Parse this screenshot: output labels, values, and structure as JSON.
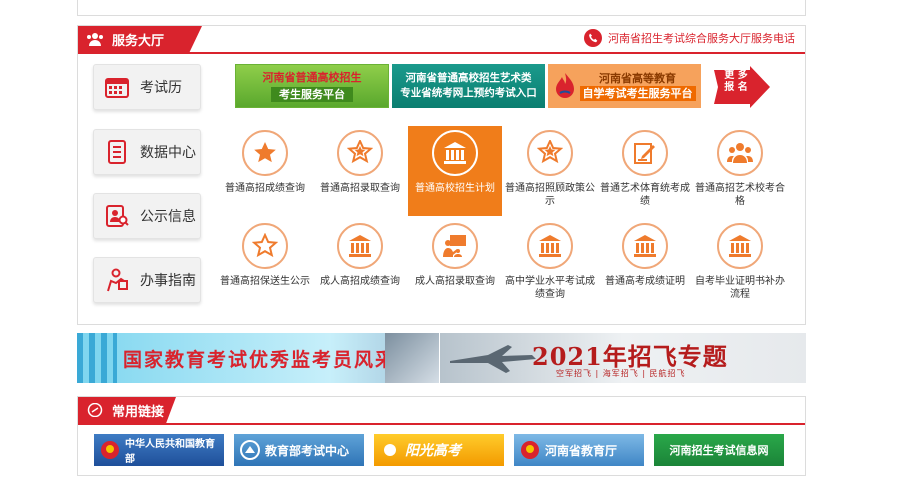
{
  "service_hall": {
    "title": "服务大厅",
    "phone_text": "河南省招生考试综合服务大厅服务电话",
    "side_menu": [
      {
        "label": "考试历",
        "icon": "calendar-icon"
      },
      {
        "label": "数据中心",
        "icon": "document-icon"
      },
      {
        "label": "公示信息",
        "icon": "person-search-icon"
      },
      {
        "label": "办事指南",
        "icon": "guide-icon"
      }
    ],
    "promos": {
      "p1_line1": "河南省普通高校招生",
      "p1_line2": "考生服务平台",
      "p2_line1": "河南省普通高校招生艺术类",
      "p2_line2": "专业省统考网上预约考试入口",
      "p3_line1": "河南省高等教育",
      "p3_line2": "自学考试考生服务平台",
      "more_line1": "更 多",
      "more_line2": "报 名"
    },
    "services": [
      {
        "label": "普通高招成绩查询",
        "icon": "star-filled-icon"
      },
      {
        "label": "普通高招录取查询",
        "icon": "star-badge-icon"
      },
      {
        "label": "普通高校招生计划",
        "icon": "institution-icon",
        "active": true
      },
      {
        "label": "普通高招照顾政策公示",
        "icon": "star-badge-icon"
      },
      {
        "label": "普通艺术体育统考成绩",
        "icon": "pen-note-icon"
      },
      {
        "label": "普通高招艺术校考合格",
        "icon": "people-icon"
      },
      {
        "label": "普通高招保送生公示",
        "icon": "star-outline-icon"
      },
      {
        "label": "成人高招成绩查询",
        "icon": "institution-icon"
      },
      {
        "label": "成人高招录取查询",
        "icon": "presentation-icon"
      },
      {
        "label": "高中学业水平考试成绩查询",
        "icon": "institution-icon"
      },
      {
        "label": "普通高考成绩证明",
        "icon": "institution-icon"
      },
      {
        "label": "自考毕业证明书补办流程",
        "icon": "institution-icon"
      }
    ]
  },
  "banners": {
    "b1": "国家教育考试优秀监考员风采",
    "b2_title": "2021年招飞专题",
    "b2_sub": "空军招飞 | 海军招飞 | 民航招飞"
  },
  "links": {
    "title": "常用链接",
    "items": [
      "中华人民共和国教育部",
      "教育部考试中心",
      "阳光高考",
      "河南省教育厅",
      "河南招生考试信息网"
    ]
  },
  "colors": {
    "accent_red": "#d9232d",
    "active_orange": "#f07d1a",
    "icon_orange": "#ef7b2d"
  }
}
